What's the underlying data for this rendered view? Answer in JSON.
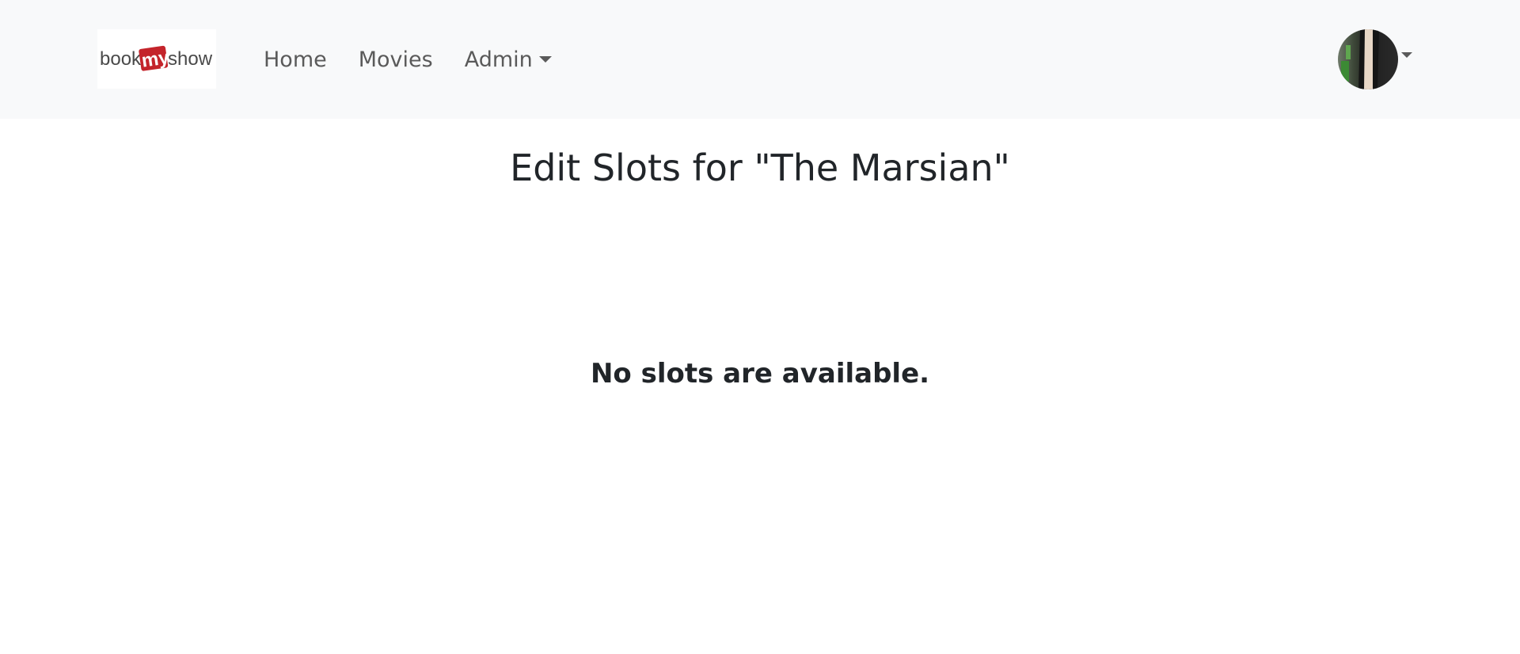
{
  "brand": {
    "logo_text_left": "book",
    "logo_text_middle": "my",
    "logo_text_right": "show",
    "accent_color": "#c4242b"
  },
  "nav": {
    "items": [
      {
        "label": "Home"
      },
      {
        "label": "Movies"
      },
      {
        "label": "Admin"
      }
    ]
  },
  "user_menu": {
    "icon": "avatar-icon"
  },
  "main": {
    "title": "Edit Slots for \"The Marsian\"",
    "empty_message": "No slots are available."
  }
}
